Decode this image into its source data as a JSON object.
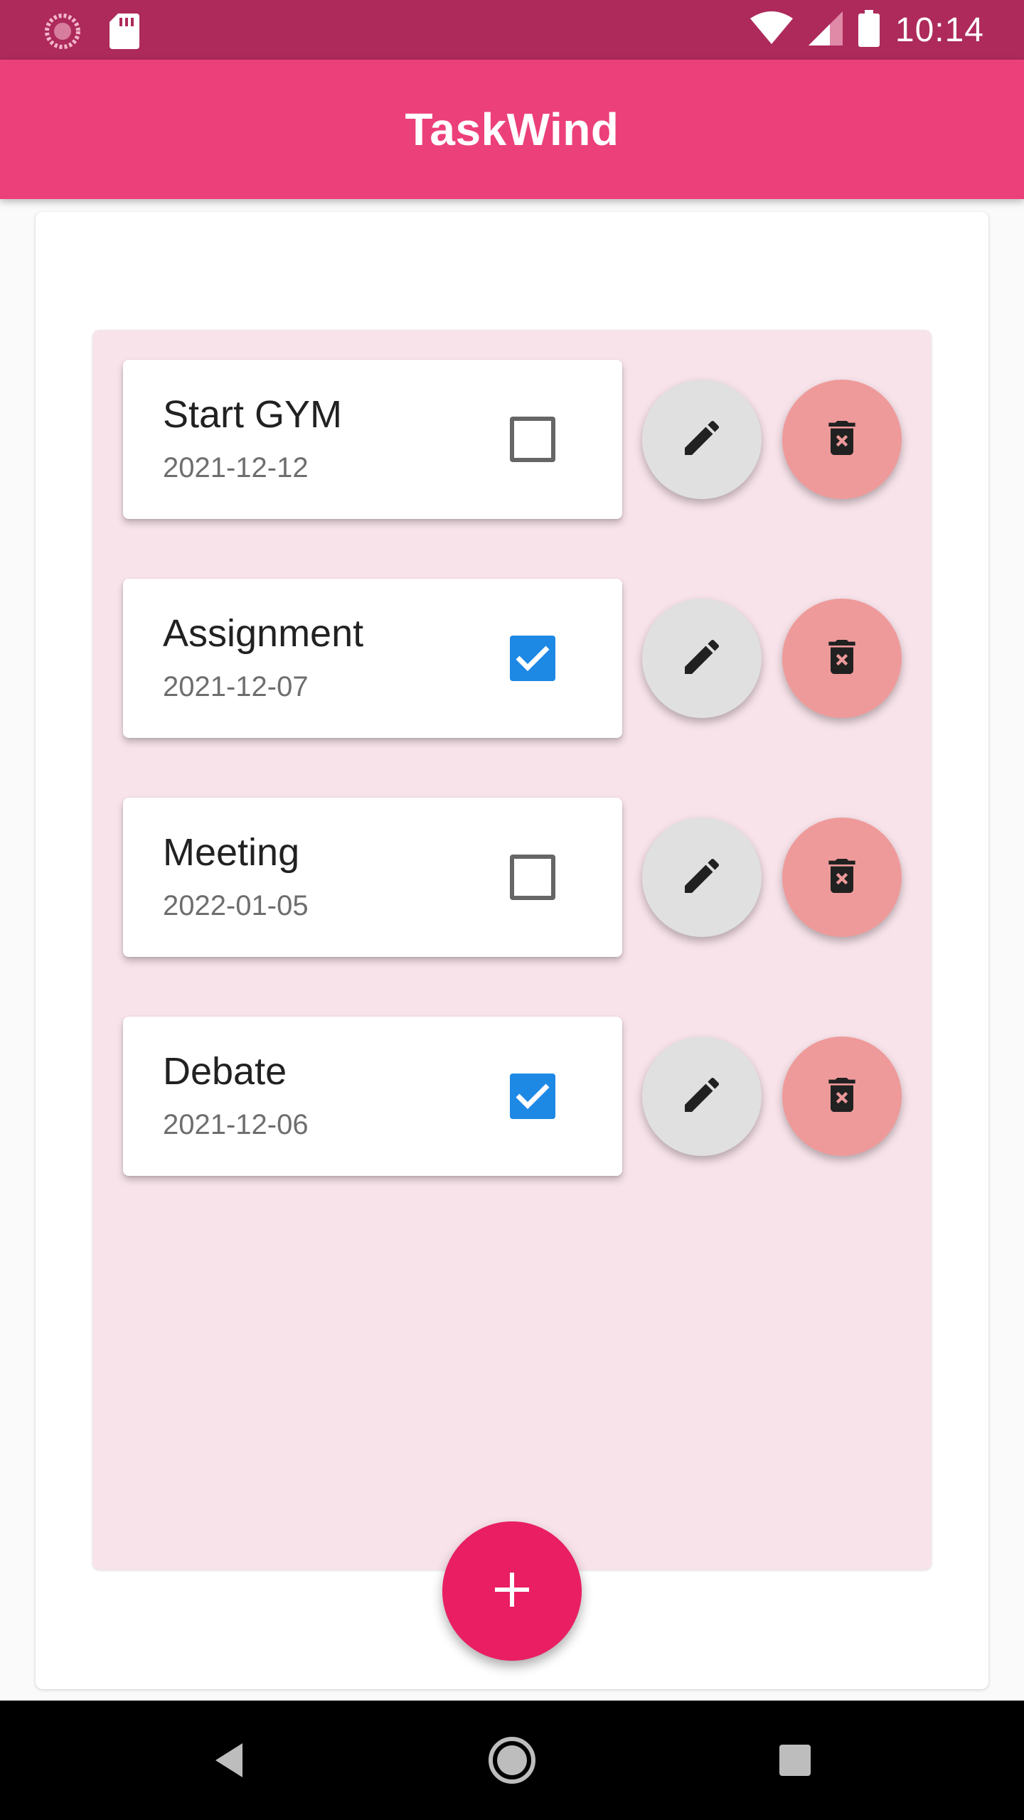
{
  "status_bar": {
    "time": "10:14",
    "icons": [
      "sync-icon",
      "sd-card-icon",
      "wifi-icon",
      "signal-icon",
      "battery-icon"
    ]
  },
  "app_bar": {
    "title": "TaskWind"
  },
  "colors": {
    "status_bar": "#ad2a5b",
    "app_bar": "#ec407a",
    "panel": "#f8e3ea",
    "checkbox_checked": "#1e88e5",
    "edit_button": "#e0e0e0",
    "delete_button": "#ef9a9a",
    "add_button": "#e91e63"
  },
  "tasks": [
    {
      "title": "Start GYM",
      "date": "2021-12-12",
      "done": false
    },
    {
      "title": "Assignment",
      "date": "2021-12-07",
      "done": true
    },
    {
      "title": "Meeting",
      "date": "2022-01-05",
      "done": false
    },
    {
      "title": "Debate",
      "date": "2021-12-06",
      "done": true
    }
  ],
  "actions": {
    "edit_icon": "pencil-icon",
    "delete_icon": "trash-icon",
    "add_icon": "plus-icon"
  },
  "nav_bar": {
    "buttons": [
      "back-icon",
      "home-icon",
      "recents-icon"
    ]
  }
}
